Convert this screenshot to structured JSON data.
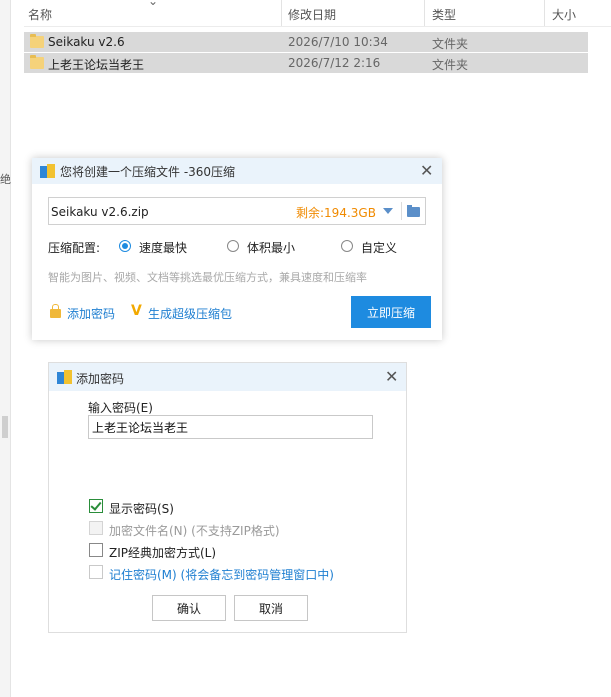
{
  "explorer": {
    "columns": {
      "name": "名称",
      "modified": "修改日期",
      "type": "类型",
      "size": "大小"
    },
    "left_glyph": "绝",
    "files": [
      {
        "name": "Seikaku v2.6",
        "modified": "2026/7/10 10:34",
        "type": "文件夹"
      },
      {
        "name": "上老王论坛当老王",
        "modified": "2026/7/12 2:16",
        "type": "文件夹"
      }
    ]
  },
  "compress_dialog": {
    "title": "您将创建一个压缩文件 -360压缩",
    "close": "✕",
    "filename": "Seikaku v2.6.zip",
    "free_space": "剩余:194.3GB",
    "config_label": "压缩配置:",
    "options": [
      {
        "label": "速度最快",
        "selected": true
      },
      {
        "label": "体积最小",
        "selected": false
      },
      {
        "label": "自定义",
        "selected": false
      }
    ],
    "hint": "智能为图片、视频、文档等挑选最优压缩方式，兼具速度和压缩率",
    "add_password": "添加密码",
    "super_pack": "生成超级压缩包",
    "compress_button": "立即压缩"
  },
  "password_dialog": {
    "title": "添加密码",
    "close": "✕",
    "input_label": "输入密码(E)",
    "password_value": "上老王论坛当老王",
    "checkboxes": [
      {
        "label": "显示密码(S)",
        "checked": true,
        "enabled": true
      },
      {
        "label": "加密文件名(N) (不支持ZIP格式)",
        "checked": false,
        "enabled": false
      },
      {
        "label": "ZIP经典加密方式(L)",
        "checked": false,
        "enabled": true
      },
      {
        "label": "记住密码(M) (将会备忘到密码管理窗口中)",
        "checked": false,
        "enabled": true
      }
    ],
    "ok": "确认",
    "cancel": "取消"
  },
  "colors": {
    "accent": "#1e8be0",
    "free_space": "#f08a00",
    "link": "#1f7fd1",
    "title_bar": "#eaf3fb",
    "selected_row": "#d9d9d9"
  }
}
